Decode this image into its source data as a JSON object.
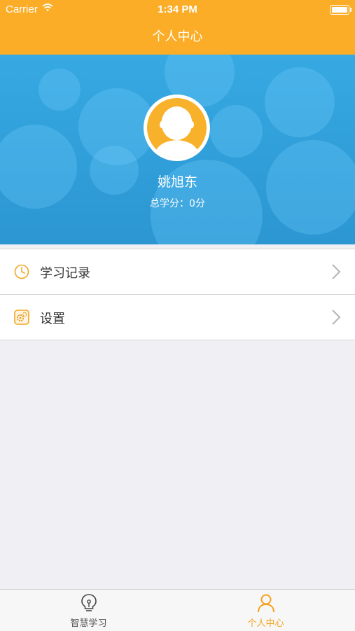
{
  "status_bar": {
    "carrier": "Carrier",
    "time": "1:34 PM"
  },
  "nav": {
    "title": "个人中心"
  },
  "profile": {
    "name": "姚旭东",
    "total_credits": "总学分：0分"
  },
  "menu": [
    {
      "label": "学习记录",
      "icon": "clock-icon"
    },
    {
      "label": "设置",
      "icon": "settings-icon"
    }
  ],
  "tabs": [
    {
      "label": "智慧学习",
      "icon": "lightbulb-icon",
      "active": false
    },
    {
      "label": "个人中心",
      "icon": "person-icon",
      "active": true
    }
  ],
  "colors": {
    "accent": "#fbad27",
    "hero": "#2f9fd9",
    "tab_active": "#f4a21e",
    "tab_inactive": "#555555"
  }
}
